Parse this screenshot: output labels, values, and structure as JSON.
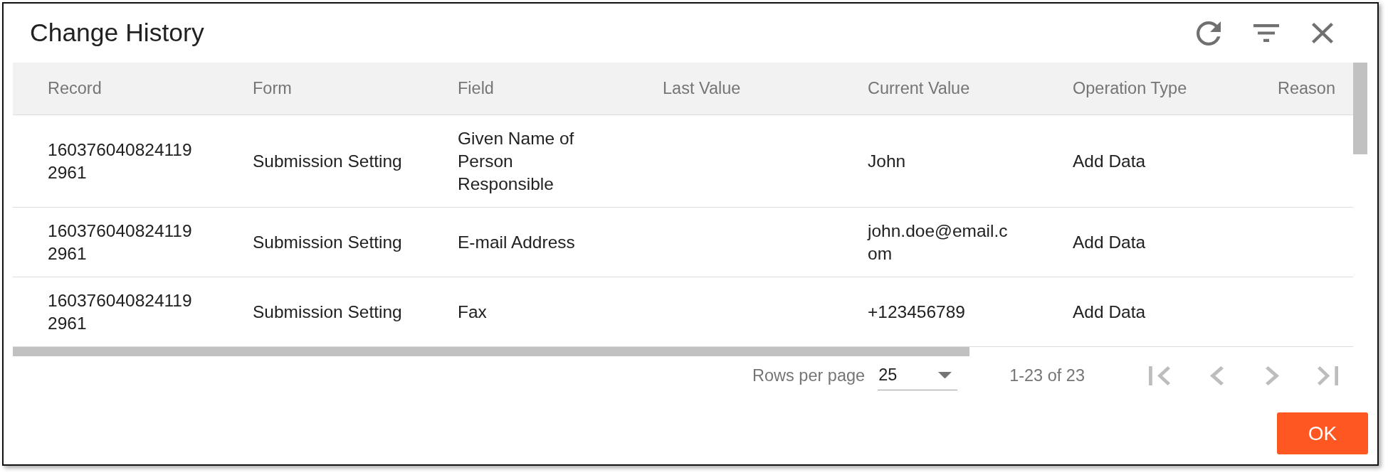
{
  "dialog": {
    "title": "Change History"
  },
  "table": {
    "columns": [
      "Record",
      "Form",
      "Field",
      "Last Value",
      "Current Value",
      "Operation Type",
      "Reason"
    ],
    "rows": [
      {
        "record": "1603760408241192961",
        "form": "Submission Setting",
        "field": "Given Name of Person Responsible",
        "current_value": "John",
        "operation_type": "Add Data"
      },
      {
        "record": "1603760408241192961",
        "form": "Submission Setting",
        "field": "E-mail Address",
        "current_value": "john.doe@email.com",
        "operation_type": "Add Data"
      },
      {
        "record": "1603760408241192961",
        "form": "Submission Setting",
        "field": "Fax",
        "current_value": "+123456789",
        "operation_type": "Add Data"
      }
    ]
  },
  "pagination": {
    "rows_per_page_label": "Rows per page",
    "rows_per_page": "25",
    "range": "1-23 of 23",
    "nav": [
      {
        "kind": "first",
        "disabled": true
      },
      {
        "kind": "previous",
        "disabled": true
      },
      {
        "kind": "next",
        "disabled": true
      },
      {
        "kind": "last",
        "disabled": true
      }
    ]
  },
  "actions": [
    {
      "label": "OK"
    }
  ]
}
